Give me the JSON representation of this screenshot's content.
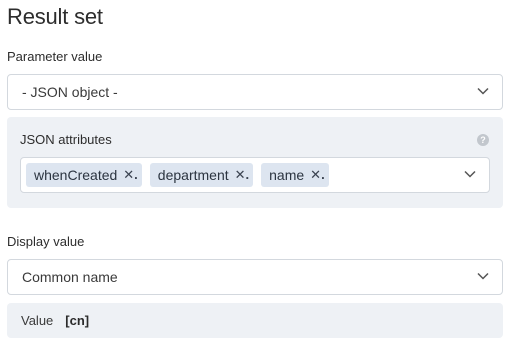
{
  "header": {
    "title": "Result set"
  },
  "parameter": {
    "label": "Parameter value",
    "selected": "- JSON object -"
  },
  "json_attributes": {
    "label": "JSON attributes",
    "help_icon": "question-icon",
    "tags": [
      "whenCreated",
      "department",
      "name"
    ],
    "remove_glyph": "✕."
  },
  "display": {
    "label": "Display value",
    "selected": "Common name"
  },
  "value_row": {
    "label": "Value",
    "value": "[cn]"
  }
}
